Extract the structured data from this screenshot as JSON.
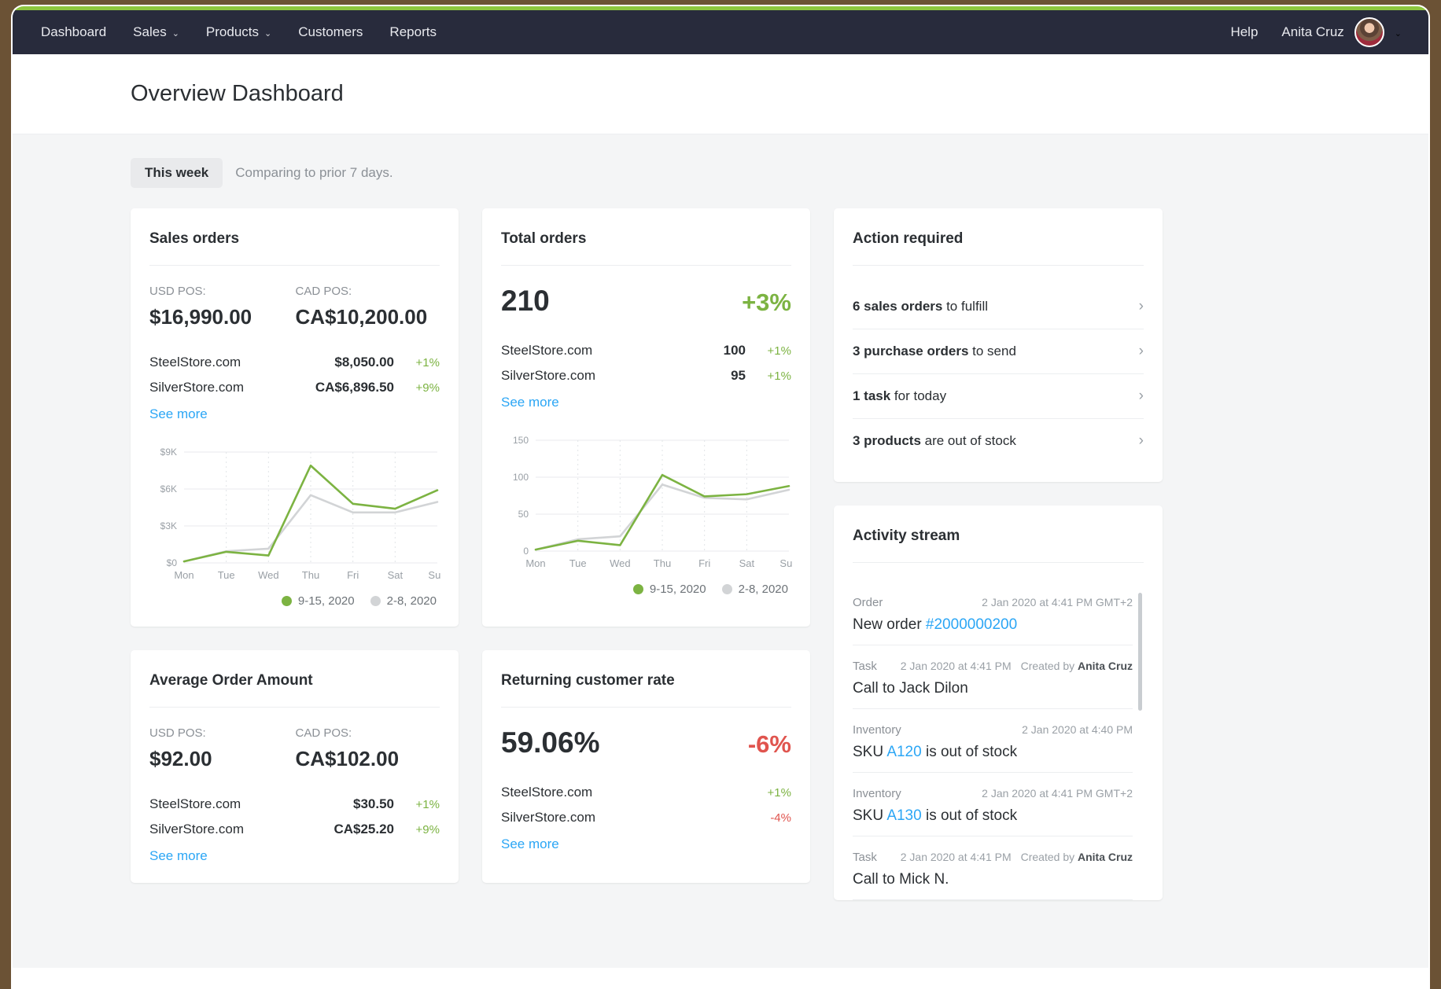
{
  "brand": {
    "accent_green": "#8dc63f",
    "nav_bg": "#282b3c",
    "link_blue": "#2ba6f5",
    "positive": "#7cb342",
    "negative": "#e0544e"
  },
  "nav": {
    "items": [
      {
        "label": "Dashboard",
        "has_caret": false
      },
      {
        "label": "Sales",
        "has_caret": true
      },
      {
        "label": "Products",
        "has_caret": true
      },
      {
        "label": "Customers",
        "has_caret": false
      },
      {
        "label": "Reports",
        "has_caret": false
      }
    ],
    "help": "Help",
    "user": "Anita Cruz",
    "caret": "⌄"
  },
  "header": {
    "title": "Overview Dashboard"
  },
  "period": {
    "chip": "This week",
    "note": "Comparing to prior 7 days."
  },
  "cards": {
    "sales_orders": {
      "title": "Sales orders",
      "usd_label": "USD POS:",
      "usd_value": "$16,990.00",
      "cad_label": "CAD POS:",
      "cad_value": "CA$10,200.00",
      "stores": [
        {
          "name": "SteelStore.com",
          "amount": "$8,050.00",
          "delta": "+1%",
          "dir": "pos"
        },
        {
          "name": "SilverStore.com",
          "amount": "CA$6,896.50",
          "delta": "+9%",
          "dir": "pos"
        }
      ],
      "see_more": "See more"
    },
    "total_orders": {
      "title": "Total orders",
      "value": "210",
      "delta": "+3%",
      "dir": "pos",
      "stores": [
        {
          "name": "SteelStore.com",
          "amount": "100",
          "delta": "+1%",
          "dir": "pos"
        },
        {
          "name": "SilverStore.com",
          "amount": "95",
          "delta": "+1%",
          "dir": "pos"
        }
      ],
      "see_more": "See more"
    },
    "avg_order": {
      "title": "Average Order Amount",
      "usd_label": "USD POS:",
      "usd_value": "$92.00",
      "cad_label": "CAD POS:",
      "cad_value": "CA$102.00",
      "stores": [
        {
          "name": "SteelStore.com",
          "amount": "$30.50",
          "delta": "+1%",
          "dir": "pos"
        },
        {
          "name": "SilverStore.com",
          "amount": "CA$25.20",
          "delta": "+9%",
          "dir": "pos"
        }
      ],
      "see_more": "See more"
    },
    "returning_rate": {
      "title": "Returning customer rate",
      "value": "59.06%",
      "delta": "-6%",
      "dir": "neg",
      "stores": [
        {
          "name": "SteelStore.com",
          "amount": "",
          "delta": "+1%",
          "dir": "pos"
        },
        {
          "name": "SilverStore.com",
          "amount": "",
          "delta": "-4%",
          "dir": "neg"
        }
      ],
      "see_more": "See more"
    }
  },
  "action_required": {
    "title": "Action required",
    "items": [
      {
        "bold": "6 sales orders",
        "rest": " to fulfill"
      },
      {
        "bold": "3 purchase orders",
        "rest": " to send"
      },
      {
        "bold": "1 task",
        "rest": " for today"
      },
      {
        "bold": "3 products",
        "rest": " are out of stock"
      }
    ],
    "chevron": "›"
  },
  "activity_stream": {
    "title": "Activity stream",
    "items": [
      {
        "type": "Order",
        "time": "2 Jan 2020 at 4:41 PM GMT+2",
        "created_label": "",
        "created_by": "",
        "text_pre": "New order ",
        "text_link": "#2000000200",
        "text_post": ""
      },
      {
        "type": "Task",
        "time": "2 Jan 2020 at 4:41 PM",
        "created_label": "Created by ",
        "created_by": "Anita Cruz",
        "text_pre": "Call to Jack Dilon",
        "text_link": "",
        "text_post": ""
      },
      {
        "type": "Inventory",
        "time": "2 Jan 2020 at 4:40 PM",
        "created_label": "",
        "created_by": "",
        "text_pre": "SKU ",
        "text_link": "A120",
        "text_post": " is out of stock"
      },
      {
        "type": "Inventory",
        "time": "2 Jan 2020 at 4:41 PM GMT+2",
        "created_label": "",
        "created_by": "",
        "text_pre": "SKU ",
        "text_link": "A130",
        "text_post": " is out of stock"
      },
      {
        "type": "Task",
        "time": "2 Jan 2020 at 4:41 PM",
        "created_label": "Created by ",
        "created_by": "Anita Cruz",
        "text_pre": "Call to Mick N.",
        "text_link": "",
        "text_post": ""
      }
    ]
  },
  "chart_data": [
    {
      "id": "sales_orders_chart",
      "type": "line",
      "title": "Sales orders",
      "xlabel": "",
      "ylabel": "",
      "categories": [
        "Mon",
        "Tue",
        "Wed",
        "Thu",
        "Fri",
        "Sat",
        "Sun"
      ],
      "ytick_labels": [
        "$0",
        "$3K",
        "$6K",
        "$9K"
      ],
      "ytick_values": [
        0,
        3000,
        6000,
        9000
      ],
      "ylim": [
        0,
        9000
      ],
      "grid": true,
      "legend_position": "bottom-right",
      "series": [
        {
          "name": "9-15, 2020",
          "color": "#7cb342",
          "values": [
            120,
            900,
            600,
            7900,
            4800,
            4400,
            5900
          ]
        },
        {
          "name": "2-8, 2020",
          "color": "#d2d4d6",
          "values": [
            120,
            950,
            1150,
            5500,
            4100,
            4100,
            4950
          ]
        }
      ]
    },
    {
      "id": "total_orders_chart",
      "type": "line",
      "title": "Total orders",
      "xlabel": "",
      "ylabel": "",
      "categories": [
        "Mon",
        "Tue",
        "Wed",
        "Thu",
        "Fri",
        "Sat",
        "Sun"
      ],
      "ytick_labels": [
        "0",
        "50",
        "100",
        "150"
      ],
      "ytick_values": [
        0,
        50,
        100,
        150
      ],
      "ylim": [
        0,
        150
      ],
      "grid": true,
      "legend_position": "bottom-right",
      "series": [
        {
          "name": "9-15, 2020",
          "color": "#7cb342",
          "values": [
            2,
            14,
            8,
            103,
            74,
            77,
            88
          ]
        },
        {
          "name": "2-8, 2020",
          "color": "#d2d4d6",
          "values": [
            2,
            16,
            20,
            90,
            72,
            70,
            83
          ]
        }
      ]
    }
  ]
}
